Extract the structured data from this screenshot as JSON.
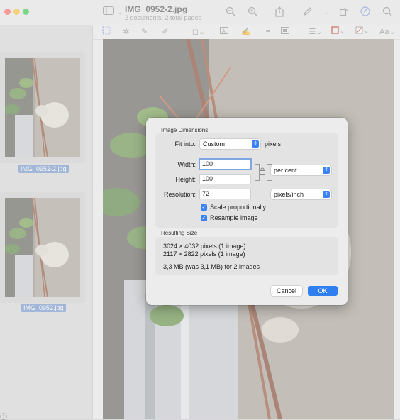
{
  "window": {
    "title": "IMG_0952-2.jpg",
    "subtitle": "2 documents, 2 total pages"
  },
  "toolbar_icons": [
    "sidebar-toggle-icon",
    "zoom-out-icon",
    "zoom-in-icon",
    "share-icon",
    "markup-pen-icon",
    "rotate-icon",
    "markup-toolbar-icon",
    "search-icon"
  ],
  "markup_icons": [
    "selection-icon",
    "instant-alpha-icon",
    "sketch-icon",
    "draw-icon",
    "shapes-icon",
    "text-icon",
    "sign-icon",
    "adjust-color-icon",
    "adjust-size-icon",
    "border-color-icon",
    "fill-color-icon",
    "text-style-icon"
  ],
  "markup_text_style": "Aa",
  "sidebar": {
    "items": [
      {
        "label": "IMG_0952-2.jpg"
      },
      {
        "label": "IMG_0952.jpg"
      }
    ]
  },
  "dialog": {
    "image_dimensions_title": "Image Dimensions",
    "fit_into_label": "Fit into:",
    "fit_into_value": "Custom",
    "fit_into_unit": "pixels",
    "width_label": "Width:",
    "width_value": "100",
    "height_label": "Height:",
    "height_value": "100",
    "size_unit": "per cent",
    "resolution_label": "Resolution:",
    "resolution_value": "72",
    "resolution_unit": "pixels/inch",
    "scale_label": "Scale proportionally",
    "scale_checked": true,
    "resample_label": "Resample image",
    "resample_checked": true,
    "resulting_size_title": "Resulting Size",
    "result_line1": "3024 × 4032 pixels (1 image)",
    "result_line2": "2117 × 2822 pixels (1 image)",
    "result_line3": "3,3 MB (was 3,1 MB) for 2 images",
    "cancel_label": "Cancel",
    "ok_label": "OK"
  },
  "colors": {
    "accent": "#2f7ff0",
    "selection_label_bg": "#6d8fc9"
  }
}
